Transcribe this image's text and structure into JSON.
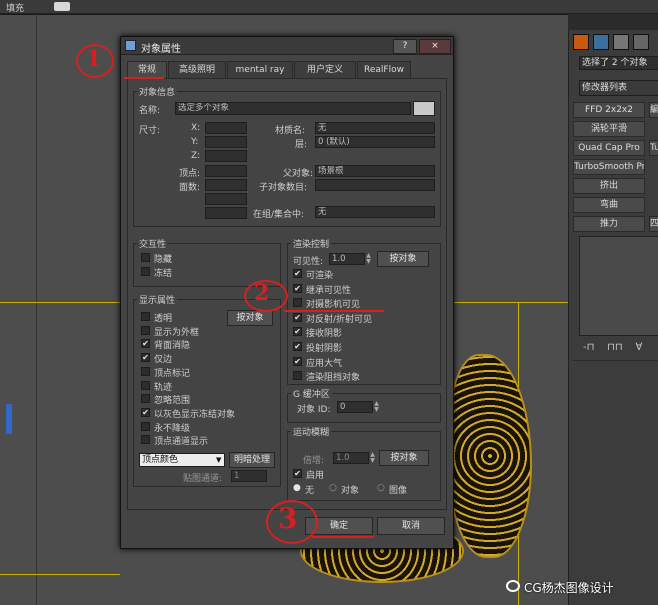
{
  "topbar": {
    "left_text": "填充"
  },
  "dialog": {
    "title": "对象属性",
    "help_button": "?",
    "close_button": "×",
    "tabs": [
      "常规",
      "高级照明",
      "mental ray",
      "用户定义",
      "RealFlow"
    ],
    "object_info": {
      "legend": "对象信息",
      "name_label": "名称:",
      "name_value": "选定多个对象",
      "dimensions_label": "尺寸:",
      "x_label": "X:",
      "y_label": "Y:",
      "z_label": "Z:",
      "vertices_label": "顶点:",
      "faces_label": "面数:",
      "material_label": "材质名:",
      "material_value": "无",
      "layer_label": "层:",
      "layer_value": "0 (默认)",
      "parent_label": "父对象:",
      "parent_value": "场景根",
      "children_label": "子对象数目:",
      "group_label": "在组/集合中:",
      "group_value": "无"
    },
    "interactivity": {
      "legend": "交互性",
      "hide": "隐藏",
      "freeze": "冻结"
    },
    "display_props": {
      "legend": "显示属性",
      "by_object_button": "按对象",
      "items": [
        {
          "label": "透明",
          "checked": false
        },
        {
          "label": "显示为外框",
          "checked": false
        },
        {
          "label": "背面消隐",
          "checked": true
        },
        {
          "label": "仅边",
          "checked": true
        },
        {
          "label": "顶点标记",
          "checked": false
        },
        {
          "label": "轨迹",
          "checked": false
        },
        {
          "label": "忽略范围",
          "checked": false
        },
        {
          "label": "以灰色显示冻结对象",
          "checked": true
        },
        {
          "label": "永不降级",
          "checked": false
        },
        {
          "label": "顶点通道显示",
          "checked": false
        }
      ],
      "vertex_color_select": "顶点颜色",
      "shading_button": "明暗处理",
      "map_channel_label": "贴图通道:",
      "map_channel_value": "1"
    },
    "render_control": {
      "legend": "渲染控制",
      "visibility_label": "可见性:",
      "visibility_value": "1.0",
      "by_object_button": "按对象",
      "items": [
        {
          "label": "可渲染",
          "checked": true
        },
        {
          "label": "继承可见性",
          "checked": true
        },
        {
          "label": "对摄影机可见",
          "checked": false
        },
        {
          "label": "对反射/折射可见",
          "checked": true
        },
        {
          "label": "接收阴影",
          "checked": true
        },
        {
          "label": "投射阴影",
          "checked": true
        },
        {
          "label": "应用大气",
          "checked": true
        },
        {
          "label": "渲染阻挡对象",
          "checked": false
        }
      ]
    },
    "gbuffer": {
      "legend": "G 缓冲区",
      "object_id_label": "对象 ID:",
      "object_id_value": "0"
    },
    "motion_blur": {
      "legend": "运动模糊",
      "multiplier_label": "倍增:",
      "multiplier_value": "1.0",
      "by_object_button": "按对象",
      "enable_label": "启用",
      "enable_checked": true,
      "radio_none": "无",
      "radio_object": "对象",
      "radio_image": "图像"
    },
    "ok_button": "确定",
    "cancel_button": "取消"
  },
  "command_panel": {
    "selection_text": "选择了 2 个对象",
    "modifier_list": "修改器列表",
    "buttons": [
      "FFD 2x2x2",
      "涡轮平滑",
      "Quad Cap Pro",
      "TurboSmooth Pro",
      "挤出",
      "弯曲",
      "推力"
    ],
    "partial_buttons": [
      "編",
      "Tu",
      "",
      "",
      "四"
    ]
  },
  "annotations": [
    "1",
    "2",
    "3"
  ],
  "watermark": "CG杨杰图像设计"
}
